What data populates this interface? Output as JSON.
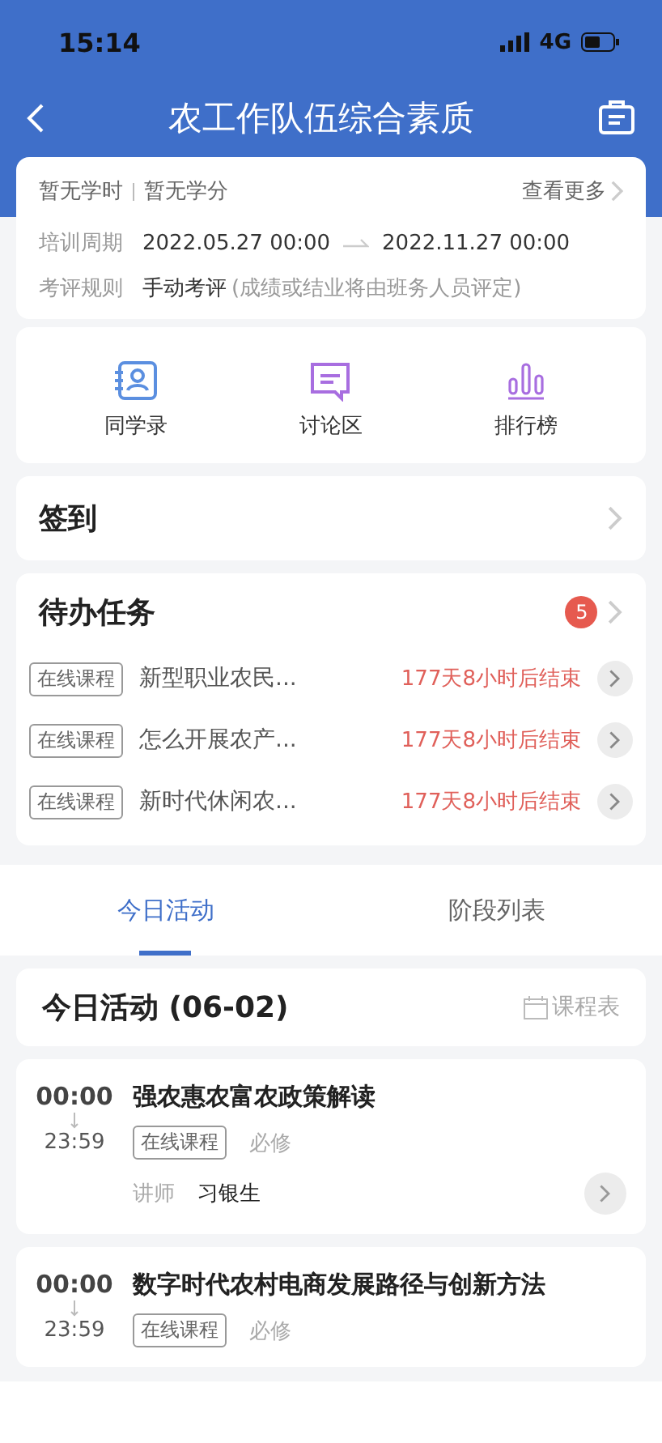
{
  "status_bar": {
    "time": "15:14",
    "network": "4G"
  },
  "nav": {
    "title": "农工作队伍综合素质"
  },
  "summary": {
    "hours": "暂无学时",
    "credits": "暂无学分",
    "more": "查看更多",
    "period_label": "培训周期",
    "period_start": "2022.05.27 00:00",
    "period_end": "2022.11.27 00:00",
    "rule_label": "考评规则",
    "rule_value": "手动考评",
    "rule_note": "(成绩或结业将由班务人员评定)"
  },
  "shortcuts": [
    {
      "label": "同学录",
      "kind": "classmates"
    },
    {
      "label": "讨论区",
      "kind": "discussion"
    },
    {
      "label": "排行榜",
      "kind": "ranking"
    }
  ],
  "checkin": {
    "title": "签到"
  },
  "tasks": {
    "title": "待办任务",
    "count": "5",
    "items": [
      {
        "tag": "在线课程",
        "name": "新型职业农民...",
        "deadline": "177天8小时后结束"
      },
      {
        "tag": "在线课程",
        "name": "怎么开展农产...",
        "deadline": "177天8小时后结束"
      },
      {
        "tag": "在线课程",
        "name": "新时代休闲农...",
        "deadline": "177天8小时后结束"
      }
    ]
  },
  "tabs": [
    {
      "label": "今日活动",
      "selected": true
    },
    {
      "label": "阶段列表",
      "selected": false
    }
  ],
  "today": {
    "title": "今日活动 (06-02)",
    "schedule": "课程表"
  },
  "activities": [
    {
      "start": "00:00",
      "end": "23:59",
      "title": "强农惠农富农政策解读",
      "tag": "在线课程",
      "requirement": "必修",
      "lecturer_label": "讲师",
      "lecturer": "习银生"
    },
    {
      "start": "00:00",
      "end": "23:59",
      "title": "数字时代农村电商发展路径与创新方法",
      "tag": "在线课程",
      "requirement": "必修"
    }
  ]
}
